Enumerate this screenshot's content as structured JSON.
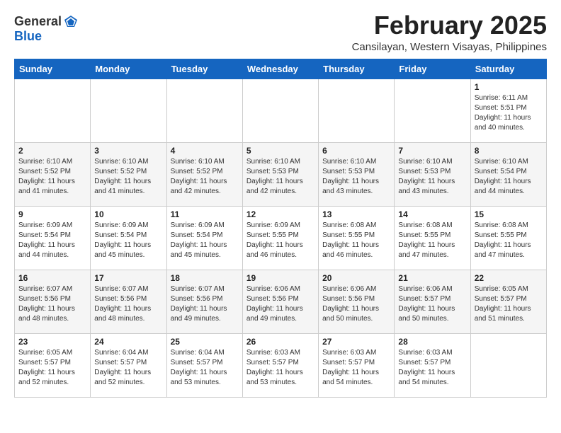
{
  "logo": {
    "general": "General",
    "blue": "Blue"
  },
  "header": {
    "month_year": "February 2025",
    "location": "Cansilayan, Western Visayas, Philippines"
  },
  "weekdays": [
    "Sunday",
    "Monday",
    "Tuesday",
    "Wednesday",
    "Thursday",
    "Friday",
    "Saturday"
  ],
  "weeks": [
    [
      {
        "day": "",
        "info": ""
      },
      {
        "day": "",
        "info": ""
      },
      {
        "day": "",
        "info": ""
      },
      {
        "day": "",
        "info": ""
      },
      {
        "day": "",
        "info": ""
      },
      {
        "day": "",
        "info": ""
      },
      {
        "day": "1",
        "info": "Sunrise: 6:11 AM\nSunset: 5:51 PM\nDaylight: 11 hours\nand 40 minutes."
      }
    ],
    [
      {
        "day": "2",
        "info": "Sunrise: 6:10 AM\nSunset: 5:52 PM\nDaylight: 11 hours\nand 41 minutes."
      },
      {
        "day": "3",
        "info": "Sunrise: 6:10 AM\nSunset: 5:52 PM\nDaylight: 11 hours\nand 41 minutes."
      },
      {
        "day": "4",
        "info": "Sunrise: 6:10 AM\nSunset: 5:52 PM\nDaylight: 11 hours\nand 42 minutes."
      },
      {
        "day": "5",
        "info": "Sunrise: 6:10 AM\nSunset: 5:53 PM\nDaylight: 11 hours\nand 42 minutes."
      },
      {
        "day": "6",
        "info": "Sunrise: 6:10 AM\nSunset: 5:53 PM\nDaylight: 11 hours\nand 43 minutes."
      },
      {
        "day": "7",
        "info": "Sunrise: 6:10 AM\nSunset: 5:53 PM\nDaylight: 11 hours\nand 43 minutes."
      },
      {
        "day": "8",
        "info": "Sunrise: 6:10 AM\nSunset: 5:54 PM\nDaylight: 11 hours\nand 44 minutes."
      }
    ],
    [
      {
        "day": "9",
        "info": "Sunrise: 6:09 AM\nSunset: 5:54 PM\nDaylight: 11 hours\nand 44 minutes."
      },
      {
        "day": "10",
        "info": "Sunrise: 6:09 AM\nSunset: 5:54 PM\nDaylight: 11 hours\nand 45 minutes."
      },
      {
        "day": "11",
        "info": "Sunrise: 6:09 AM\nSunset: 5:54 PM\nDaylight: 11 hours\nand 45 minutes."
      },
      {
        "day": "12",
        "info": "Sunrise: 6:09 AM\nSunset: 5:55 PM\nDaylight: 11 hours\nand 46 minutes."
      },
      {
        "day": "13",
        "info": "Sunrise: 6:08 AM\nSunset: 5:55 PM\nDaylight: 11 hours\nand 46 minutes."
      },
      {
        "day": "14",
        "info": "Sunrise: 6:08 AM\nSunset: 5:55 PM\nDaylight: 11 hours\nand 47 minutes."
      },
      {
        "day": "15",
        "info": "Sunrise: 6:08 AM\nSunset: 5:55 PM\nDaylight: 11 hours\nand 47 minutes."
      }
    ],
    [
      {
        "day": "16",
        "info": "Sunrise: 6:07 AM\nSunset: 5:56 PM\nDaylight: 11 hours\nand 48 minutes."
      },
      {
        "day": "17",
        "info": "Sunrise: 6:07 AM\nSunset: 5:56 PM\nDaylight: 11 hours\nand 48 minutes."
      },
      {
        "day": "18",
        "info": "Sunrise: 6:07 AM\nSunset: 5:56 PM\nDaylight: 11 hours\nand 49 minutes."
      },
      {
        "day": "19",
        "info": "Sunrise: 6:06 AM\nSunset: 5:56 PM\nDaylight: 11 hours\nand 49 minutes."
      },
      {
        "day": "20",
        "info": "Sunrise: 6:06 AM\nSunset: 5:56 PM\nDaylight: 11 hours\nand 50 minutes."
      },
      {
        "day": "21",
        "info": "Sunrise: 6:06 AM\nSunset: 5:57 PM\nDaylight: 11 hours\nand 50 minutes."
      },
      {
        "day": "22",
        "info": "Sunrise: 6:05 AM\nSunset: 5:57 PM\nDaylight: 11 hours\nand 51 minutes."
      }
    ],
    [
      {
        "day": "23",
        "info": "Sunrise: 6:05 AM\nSunset: 5:57 PM\nDaylight: 11 hours\nand 52 minutes."
      },
      {
        "day": "24",
        "info": "Sunrise: 6:04 AM\nSunset: 5:57 PM\nDaylight: 11 hours\nand 52 minutes."
      },
      {
        "day": "25",
        "info": "Sunrise: 6:04 AM\nSunset: 5:57 PM\nDaylight: 11 hours\nand 53 minutes."
      },
      {
        "day": "26",
        "info": "Sunrise: 6:03 AM\nSunset: 5:57 PM\nDaylight: 11 hours\nand 53 minutes."
      },
      {
        "day": "27",
        "info": "Sunrise: 6:03 AM\nSunset: 5:57 PM\nDaylight: 11 hours\nand 54 minutes."
      },
      {
        "day": "28",
        "info": "Sunrise: 6:03 AM\nSunset: 5:57 PM\nDaylight: 11 hours\nand 54 minutes."
      },
      {
        "day": "",
        "info": ""
      }
    ]
  ]
}
